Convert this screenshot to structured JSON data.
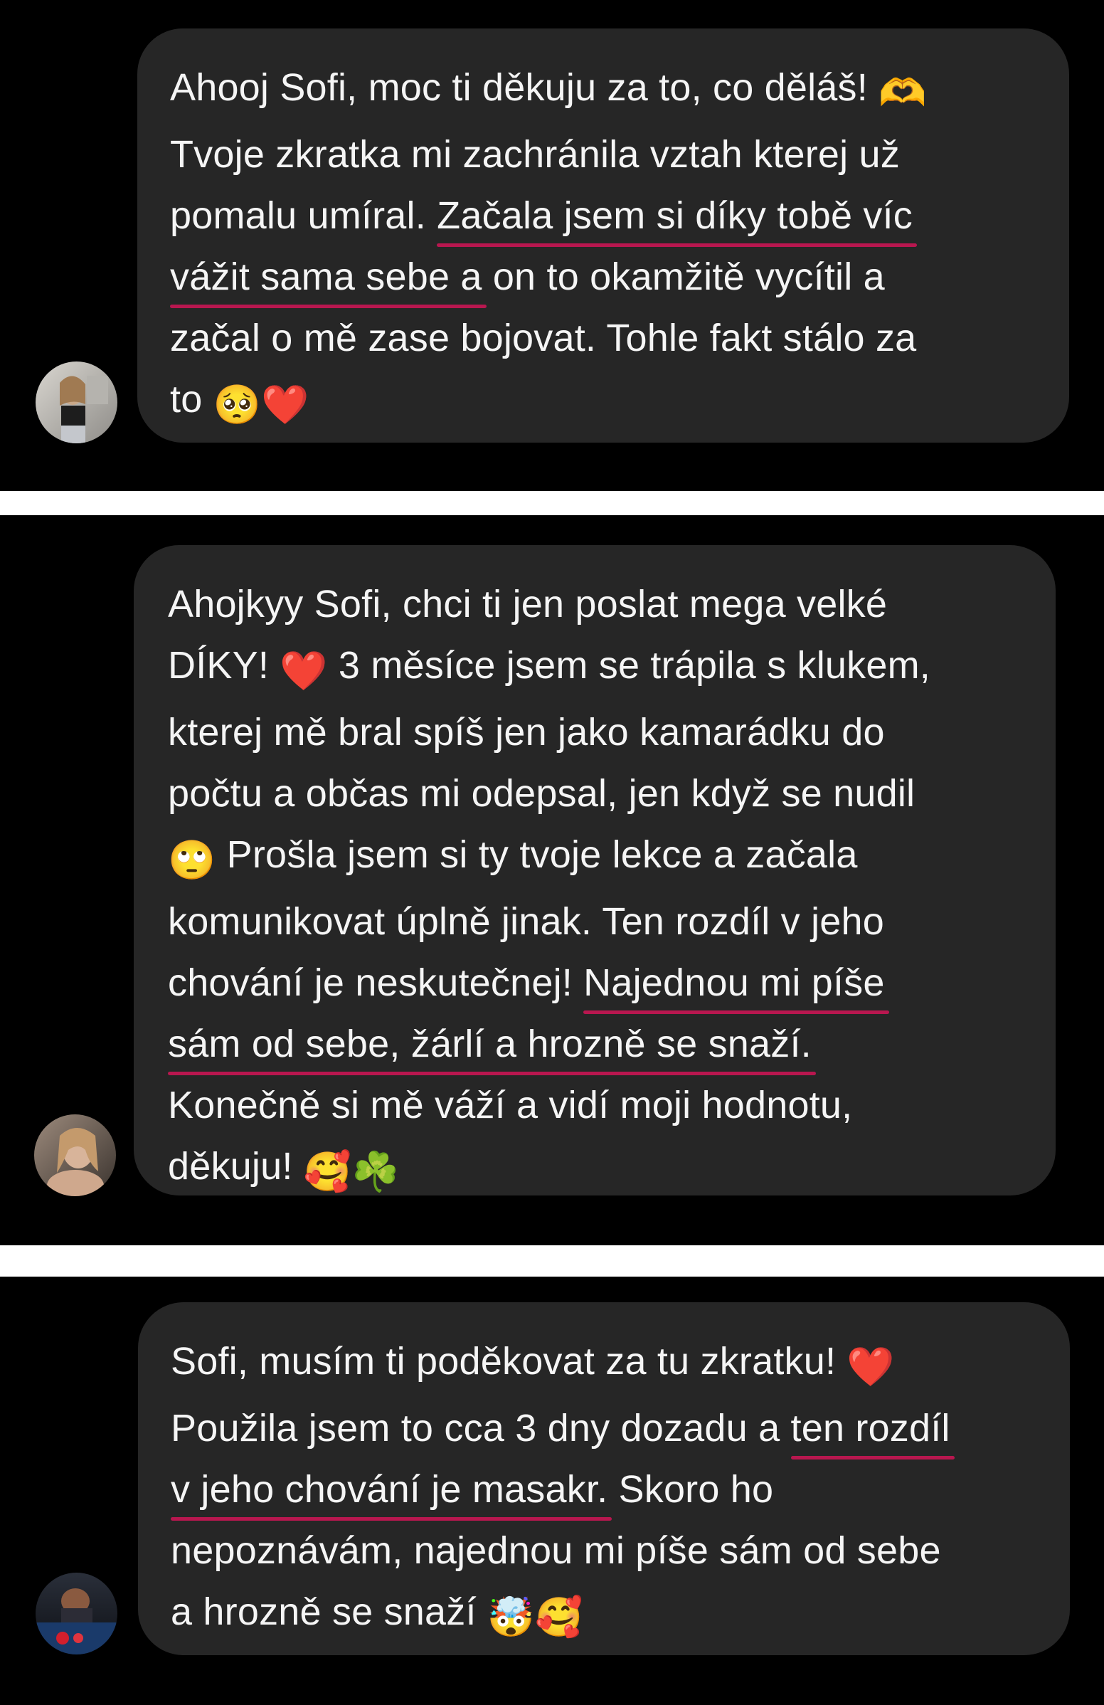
{
  "accent_underline_color": "#b8174f",
  "bubble_color": "#262626",
  "panel_color": "#000000",
  "messages": [
    {
      "avatar_icon": "user-avatar-photo",
      "lines": [
        {
          "pre": "Ahooj Sofi, moc ti děkuju za to, co děláš! ",
          "ul": "",
          "post": "",
          "emoji": "🫶"
        },
        {
          "pre": "Tvoje zkratka mi zachránila vztah kterej už",
          "ul": "",
          "post": "",
          "emoji": ""
        },
        {
          "pre": "pomalu umíral. ",
          "ul": "Začala jsem si díky tobě víc",
          "post": "",
          "emoji": ""
        },
        {
          "pre": "",
          "ul": "vážit sama sebe a",
          "post": " on to okamžitě vycítil a",
          "emoji": ""
        },
        {
          "pre": "začal o mě zase bojovat. Tohle fakt stálo za",
          "ul": "",
          "post": "",
          "emoji": ""
        },
        {
          "pre": "to ",
          "ul": "",
          "post": "",
          "emoji": "🥺❤️"
        }
      ]
    },
    {
      "avatar_icon": "user-avatar-photo",
      "lines": [
        {
          "pre": "Ahojkyy Sofi, chci ti jen poslat mega velké",
          "ul": "",
          "post": "",
          "emoji": ""
        },
        {
          "pre": "DÍKY! ",
          "ul": "",
          "post": " 3 měsíce jsem se trápila s klukem,",
          "emoji": "❤️",
          "emoji_mid": true
        },
        {
          "pre": "kterej mě bral spíš jen jako kamarádku do",
          "ul": "",
          "post": "",
          "emoji": ""
        },
        {
          "pre": "počtu a občas mi odepsal, jen když se nudil",
          "ul": "",
          "post": "",
          "emoji": ""
        },
        {
          "pre": "",
          "ul": "",
          "post": " Prošla jsem si ty tvoje lekce a začala",
          "emoji": "🙄",
          "emoji_mid": true
        },
        {
          "pre": "komunikovat úplně jinak. Ten rozdíl v jeho",
          "ul": "",
          "post": "",
          "emoji": ""
        },
        {
          "pre": "chování je neskutečnej! ",
          "ul": "Najednou mi píše",
          "post": "",
          "emoji": ""
        },
        {
          "pre": "",
          "ul": "sám od sebe, žárlí a hrozně se snaží.",
          "post": "",
          "emoji": ""
        },
        {
          "pre": "Konečně si mě váží a vidí moji hodnotu,",
          "ul": "",
          "post": "",
          "emoji": ""
        },
        {
          "pre": "děkuju! ",
          "ul": "",
          "post": "",
          "emoji": "🥰☘️"
        }
      ]
    },
    {
      "avatar_icon": "user-avatar-photo",
      "lines": [
        {
          "pre": "Sofi, musím ti poděkovat za tu zkratku! ",
          "ul": "",
          "post": "",
          "emoji": "❤️"
        },
        {
          "pre": "Použila jsem to cca 3 dny dozadu a ",
          "ul": "ten rozdíl",
          "post": "",
          "emoji": ""
        },
        {
          "pre": "",
          "ul": "v jeho chování je masakr.",
          "post": " Skoro ho",
          "emoji": ""
        },
        {
          "pre": "nepoznávám, najednou mi píše sám od sebe",
          "ul": "",
          "post": "",
          "emoji": ""
        },
        {
          "pre": "a hrozně se snaží ",
          "ul": "",
          "post": "",
          "emoji": "🤯🥰"
        }
      ]
    }
  ]
}
